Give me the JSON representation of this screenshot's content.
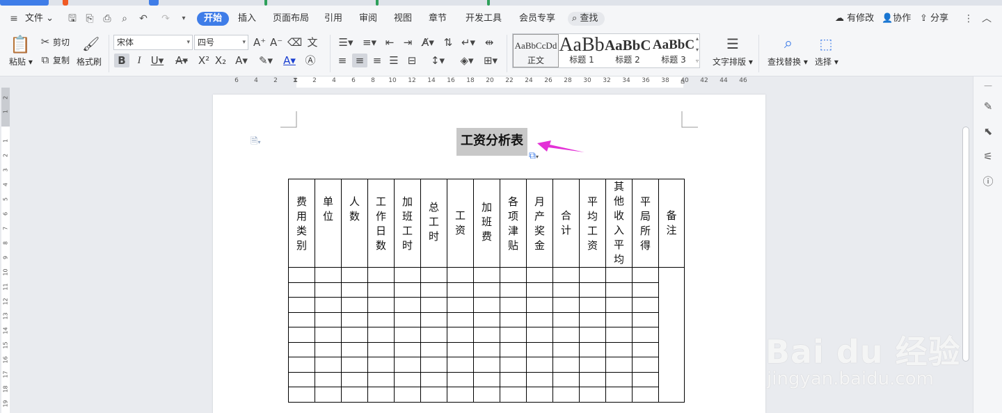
{
  "menubar": {
    "file": "文件",
    "tabs": [
      "开始",
      "插入",
      "页面布局",
      "引用",
      "审阅",
      "视图",
      "章节",
      "开发工具",
      "会员专享"
    ],
    "find": "查找",
    "right": {
      "modified": "有修改",
      "collab": "协作",
      "share": "分享"
    }
  },
  "ribbon": {
    "paste": "粘贴",
    "cut": "剪切",
    "copy": "复制",
    "format_painter": "格式刷",
    "font_name": "宋体",
    "font_size": "四号",
    "styles": [
      {
        "preview": "AaBbCcDd",
        "name": "正文"
      },
      {
        "preview": "AaBb",
        "name": "标题 1"
      },
      {
        "preview": "AaBbC",
        "name": "标题 2"
      },
      {
        "preview": "AaBbC",
        "name": "标题 3"
      }
    ],
    "text_layout": "文字排版",
    "find_replace": "查找替换",
    "select": "选择"
  },
  "ruler": {
    "h_ticks": [
      "6",
      "4",
      "2",
      "2",
      "4",
      "6",
      "8",
      "10",
      "12",
      "14",
      "16",
      "18",
      "20",
      "22",
      "24",
      "26",
      "28",
      "30",
      "32",
      "34",
      "36",
      "38",
      "40",
      "42",
      "44",
      "46"
    ],
    "v_ticks": [
      "2",
      "1",
      "1",
      "2",
      "3",
      "4",
      "5",
      "6",
      "7",
      "8",
      "9",
      "10",
      "11",
      "12",
      "13",
      "14",
      "15",
      "16",
      "17",
      "18",
      "19"
    ]
  },
  "document": {
    "title": "工资分析表",
    "headers": [
      "费用类别",
      "单位",
      "人数",
      "工作日数",
      "加班工时",
      "总工时",
      "工资",
      "加班费",
      "各项津贴",
      "月产奖金",
      "合计",
      "平均工资",
      "其他收入平均",
      "平局所得",
      "备注"
    ],
    "empty_rows": 9
  },
  "watermark": {
    "logo": "Bai du 经验",
    "url": "jingyan.baidu.com"
  },
  "colors": {
    "accent": "#3f7de8",
    "arrow": "#e331d6",
    "selection": "#c8c8c8"
  }
}
